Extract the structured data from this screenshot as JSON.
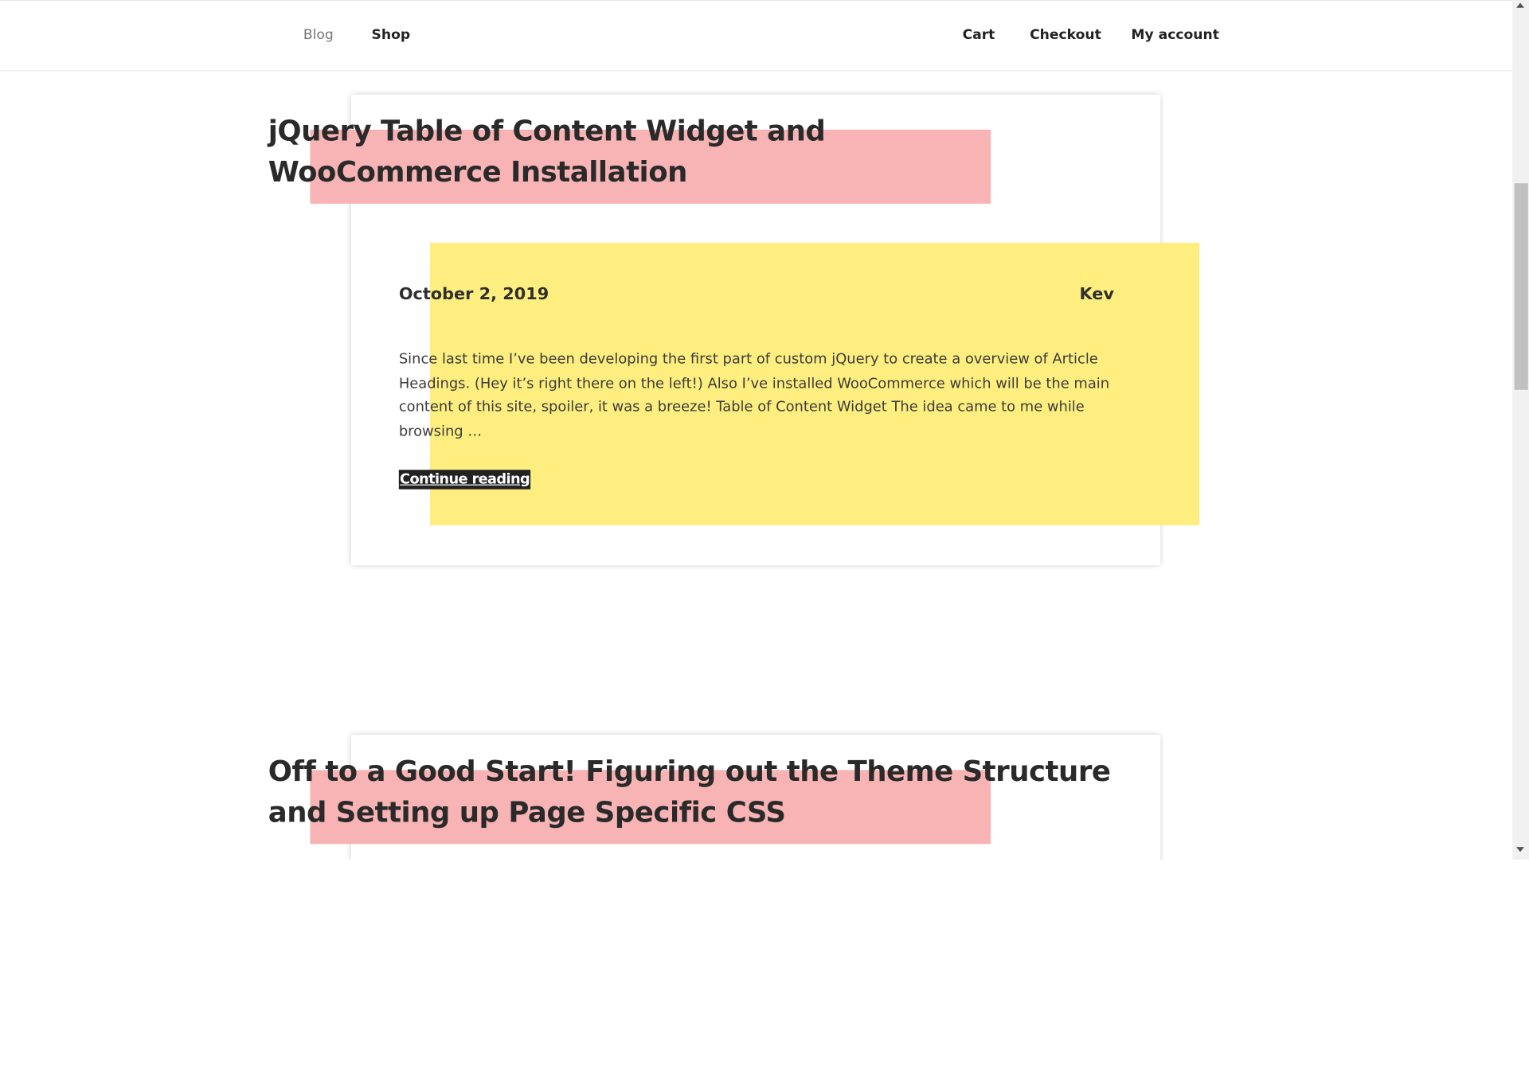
{
  "nav": {
    "left": [
      {
        "label": "Blog"
      },
      {
        "label": "Shop"
      }
    ],
    "right": [
      {
        "label": "Cart"
      },
      {
        "label": "Checkout"
      },
      {
        "label": "My account"
      }
    ]
  },
  "posts": [
    {
      "title": "jQuery Table of Content Widget and WooCommerce Installation",
      "date": "October 2, 2019",
      "author": "Kev",
      "excerpt": "Since last time I’ve been developing the first part of custom jQuery to create a overview of Article Headings. (Hey it’s right there on the left!) Also I’ve installed WooCommerce which will be the main content of this site, spoiler, it was a breeze! Table of Content Widget The idea came to me while browsing …",
      "continue_label": "Continue reading"
    },
    {
      "title": "Off to a Good Start! Figuring out the Theme Structure and Setting up Page Specific CSS"
    }
  ],
  "colors": {
    "highlight_pink": "#f8b4b4",
    "highlight_yellow": "#fdee7f",
    "continue_bg": "#222222"
  },
  "icons": {
    "scroll_up": "triangle-up-icon",
    "scroll_down": "triangle-down-icon"
  }
}
